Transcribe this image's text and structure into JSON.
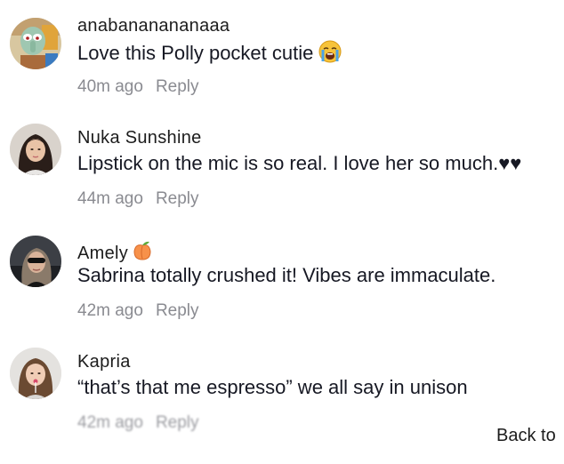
{
  "comments": [
    {
      "username": "anabananananaaa",
      "text": "Love this Polly pocket cutie",
      "emoji": "loudly-crying-face",
      "time": "40m ago",
      "reply": "Reply"
    },
    {
      "username": "Nuka Sunshine",
      "text": "Lipstick on the mic is so real. I love her so much.♥♥",
      "time": "44m ago",
      "reply": "Reply"
    },
    {
      "username": "Amely",
      "badge": "peach-emoji",
      "text": "Sabrina totally crushed it! Vibes are immaculate.",
      "time": "42m ago",
      "reply": "Reply"
    },
    {
      "username": "Kapria",
      "text": "“that’s that me espresso” we all say in unison",
      "time": "42m ago",
      "reply": "Reply"
    }
  ],
  "footer": {
    "back_label": "Back to"
  },
  "colors": {
    "username": "#1c1c1c",
    "body_text": "#161823",
    "meta_text": "#8a8b91",
    "background": "#ffffff"
  }
}
